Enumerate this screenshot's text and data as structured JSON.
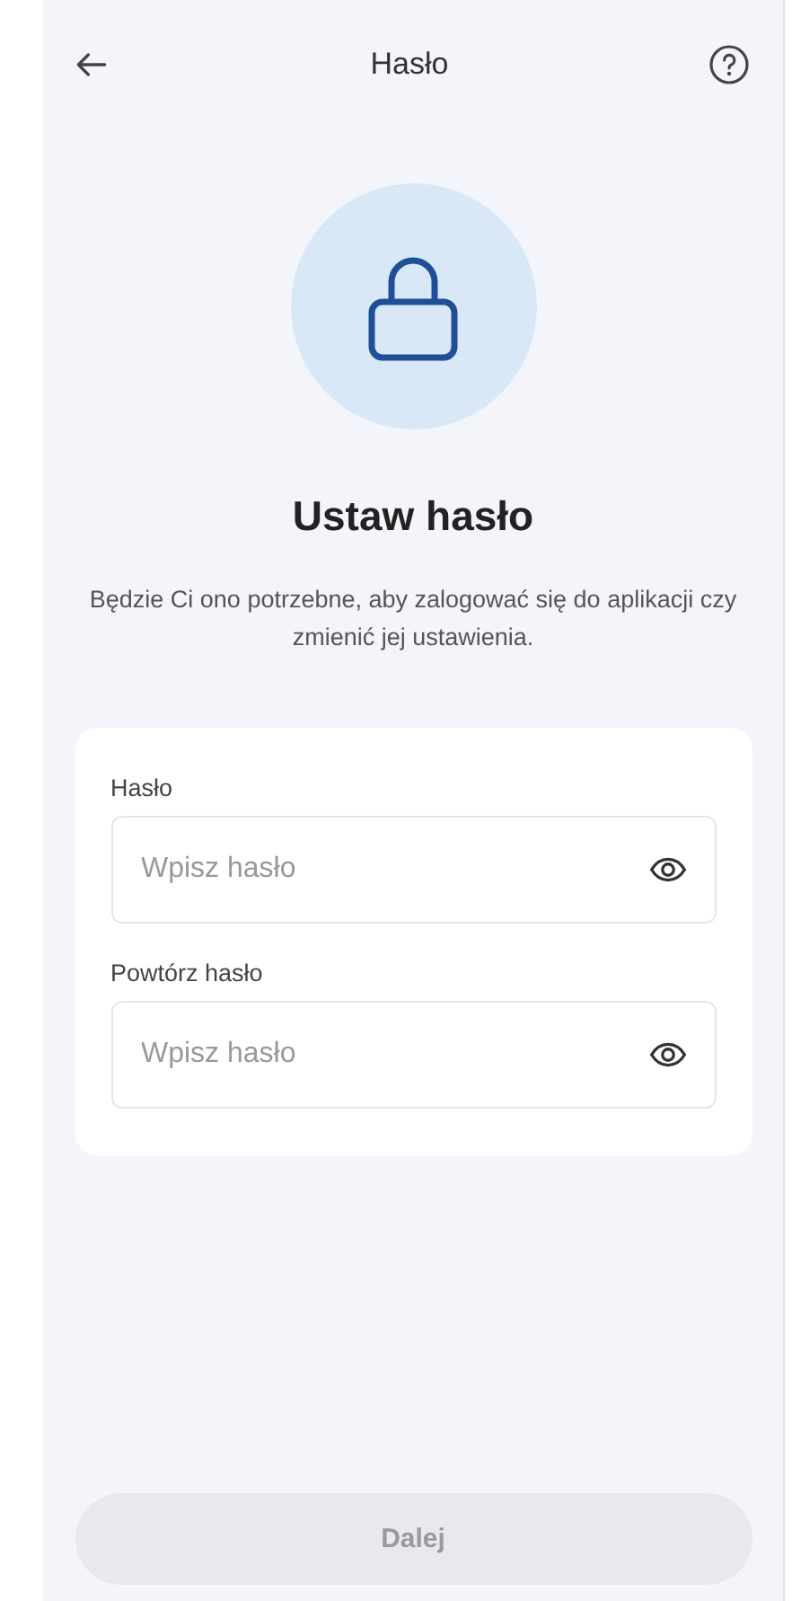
{
  "header": {
    "title": "Hasło"
  },
  "hero": {
    "title": "Ustaw hasło",
    "description": "Będzie Ci ono potrzebne, aby zalogować się do aplikacji czy zmienić jej ustawienia."
  },
  "fields": [
    {
      "label": "Hasło",
      "placeholder": "Wpisz hasło"
    },
    {
      "label": "Powtórz hasło",
      "placeholder": "Wpisz hasło"
    }
  ],
  "next_button": {
    "label": "Dalej",
    "disabled": true
  }
}
